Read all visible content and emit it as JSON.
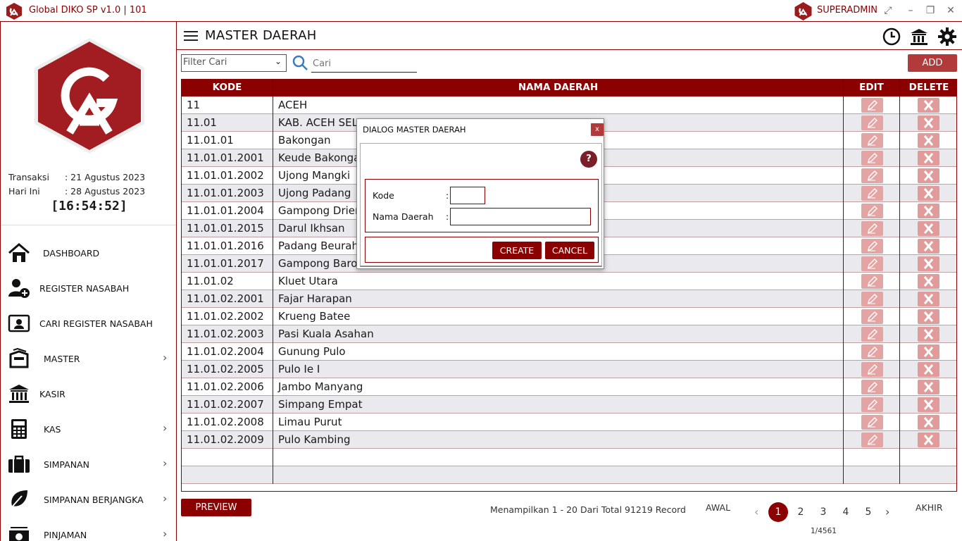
{
  "app": {
    "title": "Global DIKO SP v1.0 | 101",
    "user": "SUPERADMIN"
  },
  "colors": {
    "brand": "#8b0000",
    "accent": "#b23a3a",
    "row_alt": "#e9e9ee"
  },
  "sidebar": {
    "transaksi_label": "Transaksi",
    "transaksi_value": ": 21 Agustus 2023",
    "hari_ini_label": "Hari Ini",
    "hari_ini_value": ": 28 Agustus 2023",
    "clock": "[16:54:52]",
    "items": [
      {
        "label": "DASHBOARD",
        "icon": "home-icon"
      },
      {
        "label": "REGISTER NASABAH",
        "icon": "add-user-icon"
      },
      {
        "label": "CARI REGISTER NASABAH",
        "icon": "id-card-icon"
      },
      {
        "label": "MASTER",
        "icon": "box-icon"
      },
      {
        "label": "KASIR",
        "icon": "bank-icon"
      },
      {
        "label": "KAS",
        "icon": "calculator-icon"
      },
      {
        "label": "SIMPANAN",
        "icon": "briefcase-icon"
      },
      {
        "label": "SIMPANAN BERJANGKA",
        "icon": "leaf-icon"
      },
      {
        "label": "PINJAMAN",
        "icon": "money-icon"
      }
    ]
  },
  "header": {
    "title": "MASTER DAERAH"
  },
  "toolbar": {
    "filter_placeholder": "Filter Cari",
    "search_placeholder": "Cari",
    "add_label": "ADD"
  },
  "table": {
    "columns": [
      "KODE",
      "NAMA DAERAH",
      "EDIT",
      "DELETE"
    ],
    "rows": [
      {
        "kode": "11",
        "nama": "ACEH"
      },
      {
        "kode": "11.01",
        "nama": "KAB. ACEH SELATAN"
      },
      {
        "kode": "11.01.01",
        "nama": "Bakongan"
      },
      {
        "kode": "11.01.01.2001",
        "nama": "Keude Bakongan"
      },
      {
        "kode": "11.01.01.2002",
        "nama": "Ujong Mangki"
      },
      {
        "kode": "11.01.01.2003",
        "nama": "Ujong Padang"
      },
      {
        "kode": "11.01.01.2004",
        "nama": "Gampong Drien"
      },
      {
        "kode": "11.01.01.2015",
        "nama": "Darul Ikhsan"
      },
      {
        "kode": "11.01.01.2016",
        "nama": "Padang Beurahan"
      },
      {
        "kode": "11.01.01.2017",
        "nama": "Gampong Baro"
      },
      {
        "kode": "11.01.02",
        "nama": "Kluet Utara"
      },
      {
        "kode": "11.01.02.2001",
        "nama": "Fajar Harapan"
      },
      {
        "kode": "11.01.02.2002",
        "nama": "Krueng Batee"
      },
      {
        "kode": "11.01.02.2003",
        "nama": "Pasi Kuala Asahan"
      },
      {
        "kode": "11.01.02.2004",
        "nama": "Gunung Pulo"
      },
      {
        "kode": "11.01.02.2005",
        "nama": "Pulo Ie I"
      },
      {
        "kode": "11.01.02.2006",
        "nama": "Jambo Manyang"
      },
      {
        "kode": "11.01.02.2007",
        "nama": "Simpang Empat"
      },
      {
        "kode": "11.01.02.2008",
        "nama": "Limau Purut"
      },
      {
        "kode": "11.01.02.2009",
        "nama": "Pulo Kambing"
      }
    ]
  },
  "footer": {
    "preview_label": "PREVIEW",
    "records_text": "Menampilkan 1 - 20 Dari Total 91219 Record",
    "first_label": "AWAL",
    "last_label": "AKHIR",
    "pages": [
      "1",
      "2",
      "3",
      "4",
      "5"
    ],
    "page_info": "1/4561"
  },
  "dialog": {
    "title": "DIALOG MASTER DAERAH",
    "close_label": "x",
    "help_label": "?",
    "kode_label": "Kode",
    "nama_label": "Nama Daerah",
    "colon": ":",
    "kode_value": "",
    "nama_value": "",
    "create_label": "CREATE",
    "cancel_label": "CANCEL"
  }
}
